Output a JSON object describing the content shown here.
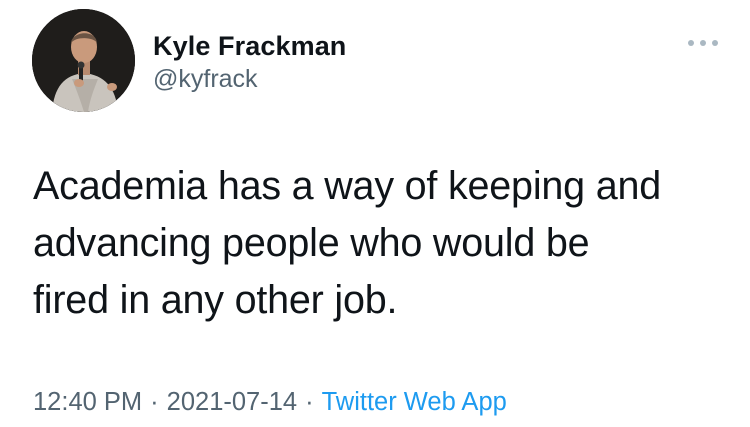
{
  "tweet": {
    "author": {
      "display_name": "Kyle Frackman",
      "handle": "@kyfrack"
    },
    "more_icon": "more-horizontal-icon",
    "text_lines": [
      "Academia has a way of keeping and",
      "advancing people who would be",
      "fired in any other job."
    ],
    "meta": {
      "time": "12:40 PM",
      "separator": "·",
      "date": "2021-07-14",
      "source": "Twitter Web App"
    }
  },
  "colors": {
    "text": "#0f1419",
    "secondary_text": "#536471",
    "link": "#1d9bf0"
  }
}
